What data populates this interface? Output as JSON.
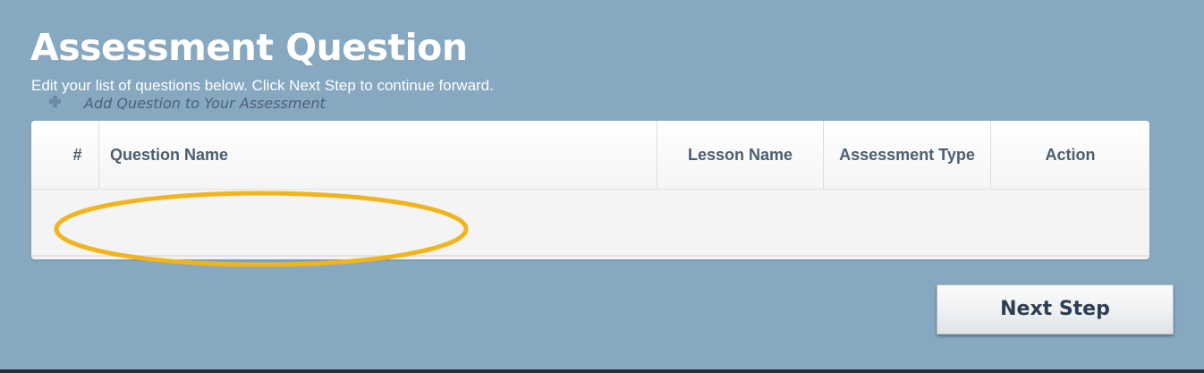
{
  "page": {
    "title": "Assessment Question",
    "subtitle": "Edit your list of questions below. Click Next Step to continue forward."
  },
  "table": {
    "columns": {
      "number": "#",
      "question_name": "Question Name",
      "lesson_name": "Lesson Name",
      "assessment_type": "Assessment Type",
      "action": "Action"
    },
    "add_question_label": "Add Question to Your Assessment"
  },
  "actions": {
    "next_step_label": "Next Step"
  },
  "icons": {
    "add": "plus-icon"
  },
  "colors": {
    "background": "#86a8c0",
    "highlight": "#f2b41c",
    "header_text": "#4b5e70",
    "button_text": "#2b3e52"
  }
}
